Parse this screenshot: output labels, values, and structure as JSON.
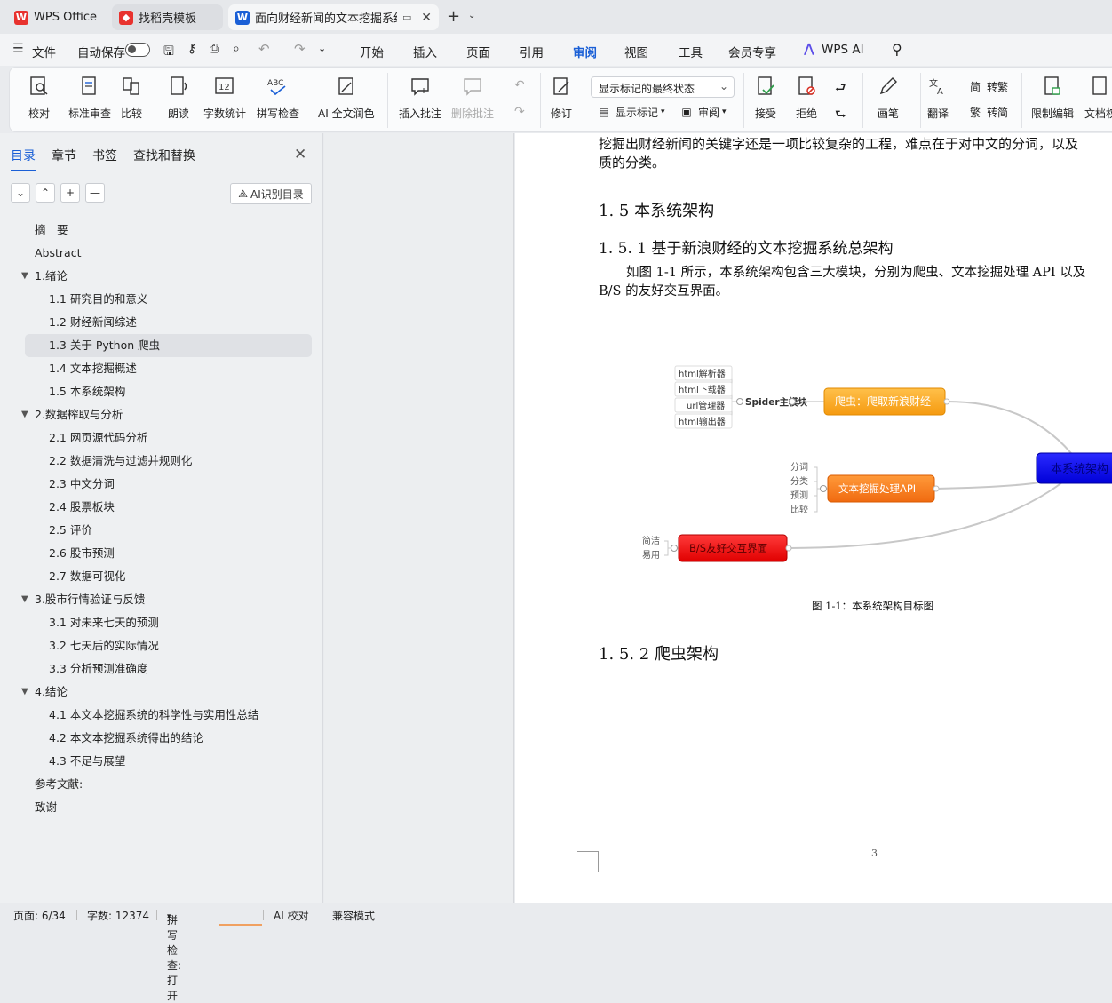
{
  "tabs": [
    {
      "label": "WPS Office"
    },
    {
      "label": "找稻壳模板"
    },
    {
      "label": "面向财经新闻的文本挖掘系统"
    }
  ],
  "menu": {
    "file": "文件",
    "autosave": "自动保存",
    "items": [
      "开始",
      "插入",
      "页面",
      "引用",
      "审阅",
      "视图",
      "工具",
      "会员专享"
    ],
    "wps_ai": "WPS AI"
  },
  "ribbon": {
    "proofread": "校对",
    "std_review": "标准审查",
    "compare": "比较",
    "read_aloud": "朗读",
    "word_count": "字数统计",
    "spell_check": "拼写检查",
    "ai_polish": "AI 全文润色",
    "insert_comment": "插入批注",
    "delete_comment": "删除批注",
    "track_changes": "修订",
    "show_markup": "显示标记",
    "review": "审阅",
    "markup_state": "显示标记的最终状态",
    "accept": "接受",
    "reject": "拒绝",
    "pen": "画笔",
    "translate": "翻译",
    "to_traditional": "转繁",
    "to_simplified": "转简",
    "restrict_edit": "限制编辑",
    "doc_rights": "文档权"
  },
  "sidebar": {
    "tabs": [
      "目录",
      "章节",
      "书签",
      "查找和替换"
    ],
    "ai_toc": "AI识别目录",
    "toc": [
      {
        "label": "摘　要",
        "level": 0
      },
      {
        "label": "Abstract",
        "level": 0
      },
      {
        "label": "1.绪论",
        "level": 0,
        "expand": true
      },
      {
        "label": "1.1  研究目的和意义",
        "level": 1
      },
      {
        "label": "1.2  财经新闻综述",
        "level": 1
      },
      {
        "label": "1.3  关于 Python 爬虫",
        "level": 1,
        "selected": true
      },
      {
        "label": "1.4  文本挖掘概述",
        "level": 1
      },
      {
        "label": "1.5 本系统架构",
        "level": 1
      },
      {
        "label": "2.数据榨取与分析",
        "level": 0,
        "expand": true
      },
      {
        "label": "2.1  网页源代码分析",
        "level": 1
      },
      {
        "label": "2.2  数据清洗与过滤并规则化",
        "level": 1
      },
      {
        "label": "2.3  中文分词",
        "level": 1
      },
      {
        "label": "2.4  股票板块",
        "level": 1
      },
      {
        "label": "2.5  评价",
        "level": 1
      },
      {
        "label": "2.6  股市预测",
        "level": 1
      },
      {
        "label": "2.7  数据可视化",
        "level": 1
      },
      {
        "label": "3.股市行情验证与反馈",
        "level": 0,
        "expand": true
      },
      {
        "label": "3.1  对未来七天的预测",
        "level": 1
      },
      {
        "label": "3.2  七天后的实际情况",
        "level": 1
      },
      {
        "label": "3.3  分析预测准确度",
        "level": 1
      },
      {
        "label": "4.结论",
        "level": 0,
        "expand": true
      },
      {
        "label": "4.1  本文本挖掘系统的科学性与实用性总结",
        "level": 1
      },
      {
        "label": "4.2  本文本挖掘系统得出的结论",
        "level": 1
      },
      {
        "label": "4.3  不足与展望",
        "level": 1
      },
      {
        "label": "参考文献:",
        "level": 0
      },
      {
        "label": "致谢",
        "level": 0
      }
    ]
  },
  "doc": {
    "para1_l1": "挖掘出财经新闻的关键字还是一项比较复杂的工程，难点在于对中文的分词，以及",
    "para1_l2": "质的分类。",
    "h15": "1. 5 本系统架构",
    "h151": "1. 5. 1  基于新浪财经的文本挖掘系统总架构",
    "para2_l1": "如图 1-1 所示，本系统架构包含三大模块，分别为爬虫、文本挖掘处理 API 以及",
    "para2_l2": "B/S 的友好交互界面。",
    "caption": "图 1-1：本系统架构目标图",
    "h152": "1. 5. 2 爬虫架构",
    "page_num": "3",
    "mindmap": {
      "spider_leaves": [
        "html解析器",
        "html下载器",
        "url管理器",
        "html输出器"
      ],
      "spider_label": "Spider主模块",
      "node_crawler": "爬虫：爬取新浪财经",
      "mining_leaves": [
        "分词",
        "分类",
        "预测",
        "比较"
      ],
      "node_mining": "文本挖掘处理API",
      "ui_leaves": [
        "简洁",
        "易用"
      ],
      "node_ui": "B/S友好交互界面",
      "root": "本系统架构"
    }
  },
  "status": {
    "page": "页面: 6/34",
    "words": "字数: 12374",
    "spell": "拼写检查: 打开",
    "ai_check": "AI 校对",
    "compat": "兼容模式"
  }
}
